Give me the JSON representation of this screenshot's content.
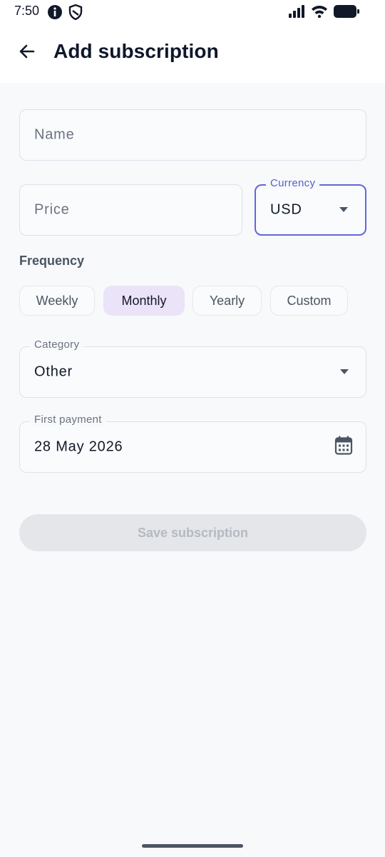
{
  "status_bar": {
    "time": "7:50",
    "left_icons": [
      "info-icon",
      "shield-icon"
    ],
    "right_icons": [
      "signal-icon",
      "wifi-icon",
      "battery-icon"
    ]
  },
  "header": {
    "back_icon": "arrow-left-icon",
    "title": "Add subscription"
  },
  "form": {
    "name": {
      "placeholder": "Name",
      "value": ""
    },
    "price": {
      "placeholder": "Price",
      "value": ""
    },
    "currency": {
      "label": "Currency",
      "value": "USD"
    },
    "frequency": {
      "label": "Frequency",
      "options": [
        "Weekly",
        "Monthly",
        "Yearly",
        "Custom"
      ],
      "selected": "Monthly"
    },
    "category": {
      "label": "Category",
      "value": "Other"
    },
    "first_payment": {
      "label": "First payment",
      "value": "28 May 2026",
      "icon": "calendar-icon"
    },
    "save_label": "Save subscription"
  },
  "colors": {
    "accent": "#6366d9",
    "chip_selected": "#ebe3f7",
    "background": "#f7f9fb",
    "disabled_button": "#e4e6ea"
  }
}
